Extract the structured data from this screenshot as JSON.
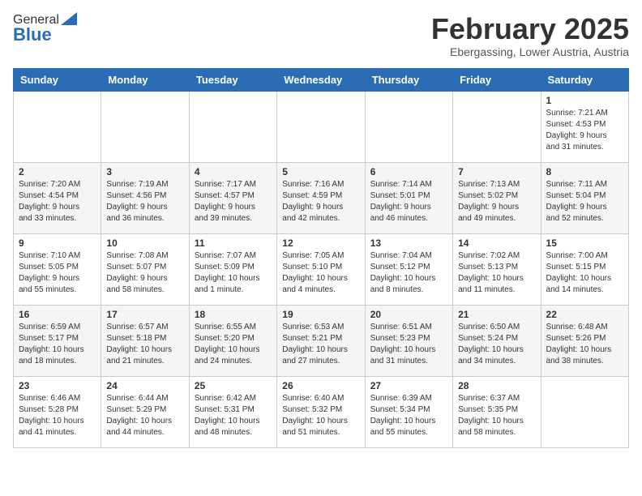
{
  "logo": {
    "general": "General",
    "blue": "Blue"
  },
  "header": {
    "month": "February 2025",
    "location": "Ebergassing, Lower Austria, Austria"
  },
  "weekdays": [
    "Sunday",
    "Monday",
    "Tuesday",
    "Wednesday",
    "Thursday",
    "Friday",
    "Saturday"
  ],
  "weeks": [
    [
      {
        "day": "",
        "info": ""
      },
      {
        "day": "",
        "info": ""
      },
      {
        "day": "",
        "info": ""
      },
      {
        "day": "",
        "info": ""
      },
      {
        "day": "",
        "info": ""
      },
      {
        "day": "",
        "info": ""
      },
      {
        "day": "1",
        "info": "Sunrise: 7:21 AM\nSunset: 4:53 PM\nDaylight: 9 hours\nand 31 minutes."
      }
    ],
    [
      {
        "day": "2",
        "info": "Sunrise: 7:20 AM\nSunset: 4:54 PM\nDaylight: 9 hours\nand 33 minutes."
      },
      {
        "day": "3",
        "info": "Sunrise: 7:19 AM\nSunset: 4:56 PM\nDaylight: 9 hours\nand 36 minutes."
      },
      {
        "day": "4",
        "info": "Sunrise: 7:17 AM\nSunset: 4:57 PM\nDaylight: 9 hours\nand 39 minutes."
      },
      {
        "day": "5",
        "info": "Sunrise: 7:16 AM\nSunset: 4:59 PM\nDaylight: 9 hours\nand 42 minutes."
      },
      {
        "day": "6",
        "info": "Sunrise: 7:14 AM\nSunset: 5:01 PM\nDaylight: 9 hours\nand 46 minutes."
      },
      {
        "day": "7",
        "info": "Sunrise: 7:13 AM\nSunset: 5:02 PM\nDaylight: 9 hours\nand 49 minutes."
      },
      {
        "day": "8",
        "info": "Sunrise: 7:11 AM\nSunset: 5:04 PM\nDaylight: 9 hours\nand 52 minutes."
      }
    ],
    [
      {
        "day": "9",
        "info": "Sunrise: 7:10 AM\nSunset: 5:05 PM\nDaylight: 9 hours\nand 55 minutes."
      },
      {
        "day": "10",
        "info": "Sunrise: 7:08 AM\nSunset: 5:07 PM\nDaylight: 9 hours\nand 58 minutes."
      },
      {
        "day": "11",
        "info": "Sunrise: 7:07 AM\nSunset: 5:09 PM\nDaylight: 10 hours\nand 1 minute."
      },
      {
        "day": "12",
        "info": "Sunrise: 7:05 AM\nSunset: 5:10 PM\nDaylight: 10 hours\nand 4 minutes."
      },
      {
        "day": "13",
        "info": "Sunrise: 7:04 AM\nSunset: 5:12 PM\nDaylight: 10 hours\nand 8 minutes."
      },
      {
        "day": "14",
        "info": "Sunrise: 7:02 AM\nSunset: 5:13 PM\nDaylight: 10 hours\nand 11 minutes."
      },
      {
        "day": "15",
        "info": "Sunrise: 7:00 AM\nSunset: 5:15 PM\nDaylight: 10 hours\nand 14 minutes."
      }
    ],
    [
      {
        "day": "16",
        "info": "Sunrise: 6:59 AM\nSunset: 5:17 PM\nDaylight: 10 hours\nand 18 minutes."
      },
      {
        "day": "17",
        "info": "Sunrise: 6:57 AM\nSunset: 5:18 PM\nDaylight: 10 hours\nand 21 minutes."
      },
      {
        "day": "18",
        "info": "Sunrise: 6:55 AM\nSunset: 5:20 PM\nDaylight: 10 hours\nand 24 minutes."
      },
      {
        "day": "19",
        "info": "Sunrise: 6:53 AM\nSunset: 5:21 PM\nDaylight: 10 hours\nand 27 minutes."
      },
      {
        "day": "20",
        "info": "Sunrise: 6:51 AM\nSunset: 5:23 PM\nDaylight: 10 hours\nand 31 minutes."
      },
      {
        "day": "21",
        "info": "Sunrise: 6:50 AM\nSunset: 5:24 PM\nDaylight: 10 hours\nand 34 minutes."
      },
      {
        "day": "22",
        "info": "Sunrise: 6:48 AM\nSunset: 5:26 PM\nDaylight: 10 hours\nand 38 minutes."
      }
    ],
    [
      {
        "day": "23",
        "info": "Sunrise: 6:46 AM\nSunset: 5:28 PM\nDaylight: 10 hours\nand 41 minutes."
      },
      {
        "day": "24",
        "info": "Sunrise: 6:44 AM\nSunset: 5:29 PM\nDaylight: 10 hours\nand 44 minutes."
      },
      {
        "day": "25",
        "info": "Sunrise: 6:42 AM\nSunset: 5:31 PM\nDaylight: 10 hours\nand 48 minutes."
      },
      {
        "day": "26",
        "info": "Sunrise: 6:40 AM\nSunset: 5:32 PM\nDaylight: 10 hours\nand 51 minutes."
      },
      {
        "day": "27",
        "info": "Sunrise: 6:39 AM\nSunset: 5:34 PM\nDaylight: 10 hours\nand 55 minutes."
      },
      {
        "day": "28",
        "info": "Sunrise: 6:37 AM\nSunset: 5:35 PM\nDaylight: 10 hours\nand 58 minutes."
      },
      {
        "day": "",
        "info": ""
      }
    ]
  ]
}
